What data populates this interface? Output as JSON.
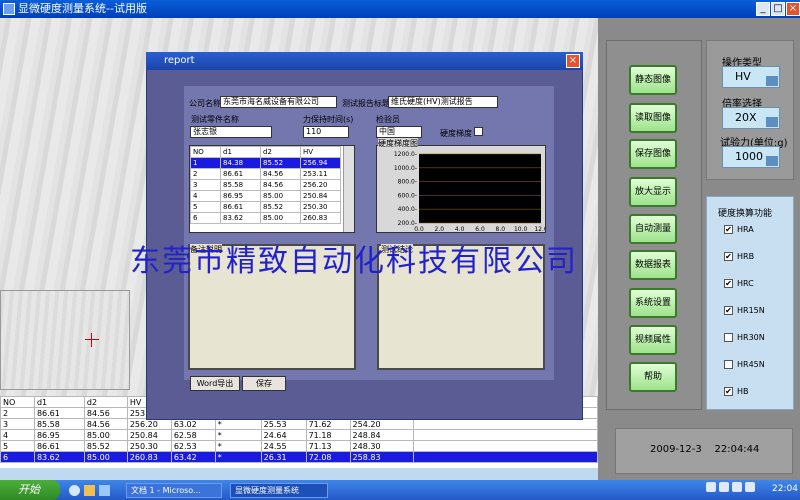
{
  "window": {
    "title": "显微硬度测量系统--试用版"
  },
  "thumb": {},
  "bottom_table": {
    "headers": [
      "NO",
      "d1",
      "d2",
      "HV",
      "",
      "",
      "",
      "",
      "",
      ""
    ],
    "rows": [
      [
        "2",
        "86.61",
        "84.56",
        "253.",
        "",
        "",
        "",
        "",
        "",
        ""
      ],
      [
        "3",
        "85.58",
        "84.56",
        "256.20",
        "63.02",
        "*",
        "25.53",
        "71.62",
        "254.20",
        ""
      ],
      [
        "4",
        "86.95",
        "85.00",
        "250.84",
        "62.58",
        "*",
        "24.64",
        "71.18",
        "248.84",
        ""
      ],
      [
        "5",
        "86.61",
        "85.52",
        "250.30",
        "62.53",
        "*",
        "24.55",
        "71.13",
        "248.30",
        ""
      ],
      [
        "6",
        "83.62",
        "85.00",
        "260.83",
        "63.42",
        "*",
        "26.31",
        "72.08",
        "258.83",
        ""
      ]
    ],
    "selected_row": 4
  },
  "right_panel": {
    "buttons": [
      "静态图像",
      "读取图像",
      "保存图像",
      "放大显示",
      "自动测量",
      "数据报表",
      "系统设置",
      "视频属性",
      "帮助"
    ],
    "operation_type_label": "操作类型",
    "operation_type_value": "HV",
    "magnification_label": "倍率选择",
    "magnification_value": "20X",
    "force_label": "试验力(单位:g)",
    "force_value": "1000",
    "conversion_label": "硬度换算功能",
    "conversions": [
      {
        "label": "HRA",
        "checked": true
      },
      {
        "label": "HRB",
        "checked": true
      },
      {
        "label": "HRC",
        "checked": true
      },
      {
        "label": "HR15N",
        "checked": true
      },
      {
        "label": "HR30N",
        "checked": false
      },
      {
        "label": "HR45N",
        "checked": false
      },
      {
        "label": "HB",
        "checked": true
      }
    ],
    "date": "2009-12-3",
    "time": "22:04:44"
  },
  "report": {
    "title": "report",
    "company_label": "公司名称",
    "company_value": "东莞市海名威设备有限公司",
    "report_title_label": "测试报告标题",
    "report_title_value": "维氏硬度(HV)测试报告",
    "part_label": "测试零件名称",
    "part_value": "张志银",
    "hold_time_label": "力保持时间(s)",
    "hold_time_value": "110",
    "inspector_label": "检验员",
    "inspector_value": "中国",
    "gradient_label": "硬度梯度",
    "table_headers": [
      "NO",
      "d1",
      "d2",
      "HV"
    ],
    "table_rows": [
      [
        "1",
        "84.38",
        "85.52",
        "256.94"
      ],
      [
        "2",
        "86.61",
        "84.56",
        "253.11"
      ],
      [
        "3",
        "85.58",
        "84.56",
        "256.20"
      ],
      [
        "4",
        "86.95",
        "85.00",
        "250.84"
      ],
      [
        "5",
        "86.61",
        "85.52",
        "250.30"
      ],
      [
        "6",
        "83.62",
        "85.00",
        "260.83"
      ]
    ],
    "selected_row": 0,
    "chart_title": "硬度梯度图",
    "panel_left_label": "备注说明",
    "panel_right_label": "测试结论",
    "word_export": "Word导出",
    "save": "保存"
  },
  "chart_data": {
    "type": "line",
    "title": "硬度梯度图",
    "xlabel": "",
    "ylabel": "",
    "x_ticks": [
      "0.0",
      "2.0",
      "4.0",
      "6.0",
      "8.0",
      "10.0",
      "12.0"
    ],
    "y_ticks": [
      "200.0-",
      "400.0-",
      "600.0-",
      "800.0-",
      "1000.0-",
      "1200.0-"
    ],
    "xlim": [
      0,
      12
    ],
    "ylim": [
      200,
      1200
    ],
    "series": [],
    "background": "#000000"
  },
  "watermark": "东莞市精致自动化科技有限公司",
  "taskbar": {
    "start": "开始",
    "tasks": [
      "文档 1 - Microso...",
      "显微硬度测量系统"
    ],
    "clock": "22:04"
  },
  "colors": {
    "selected_row": "#1a1ae0",
    "dialog_bg": "#5c5c94",
    "watermark": "#2222cc"
  }
}
